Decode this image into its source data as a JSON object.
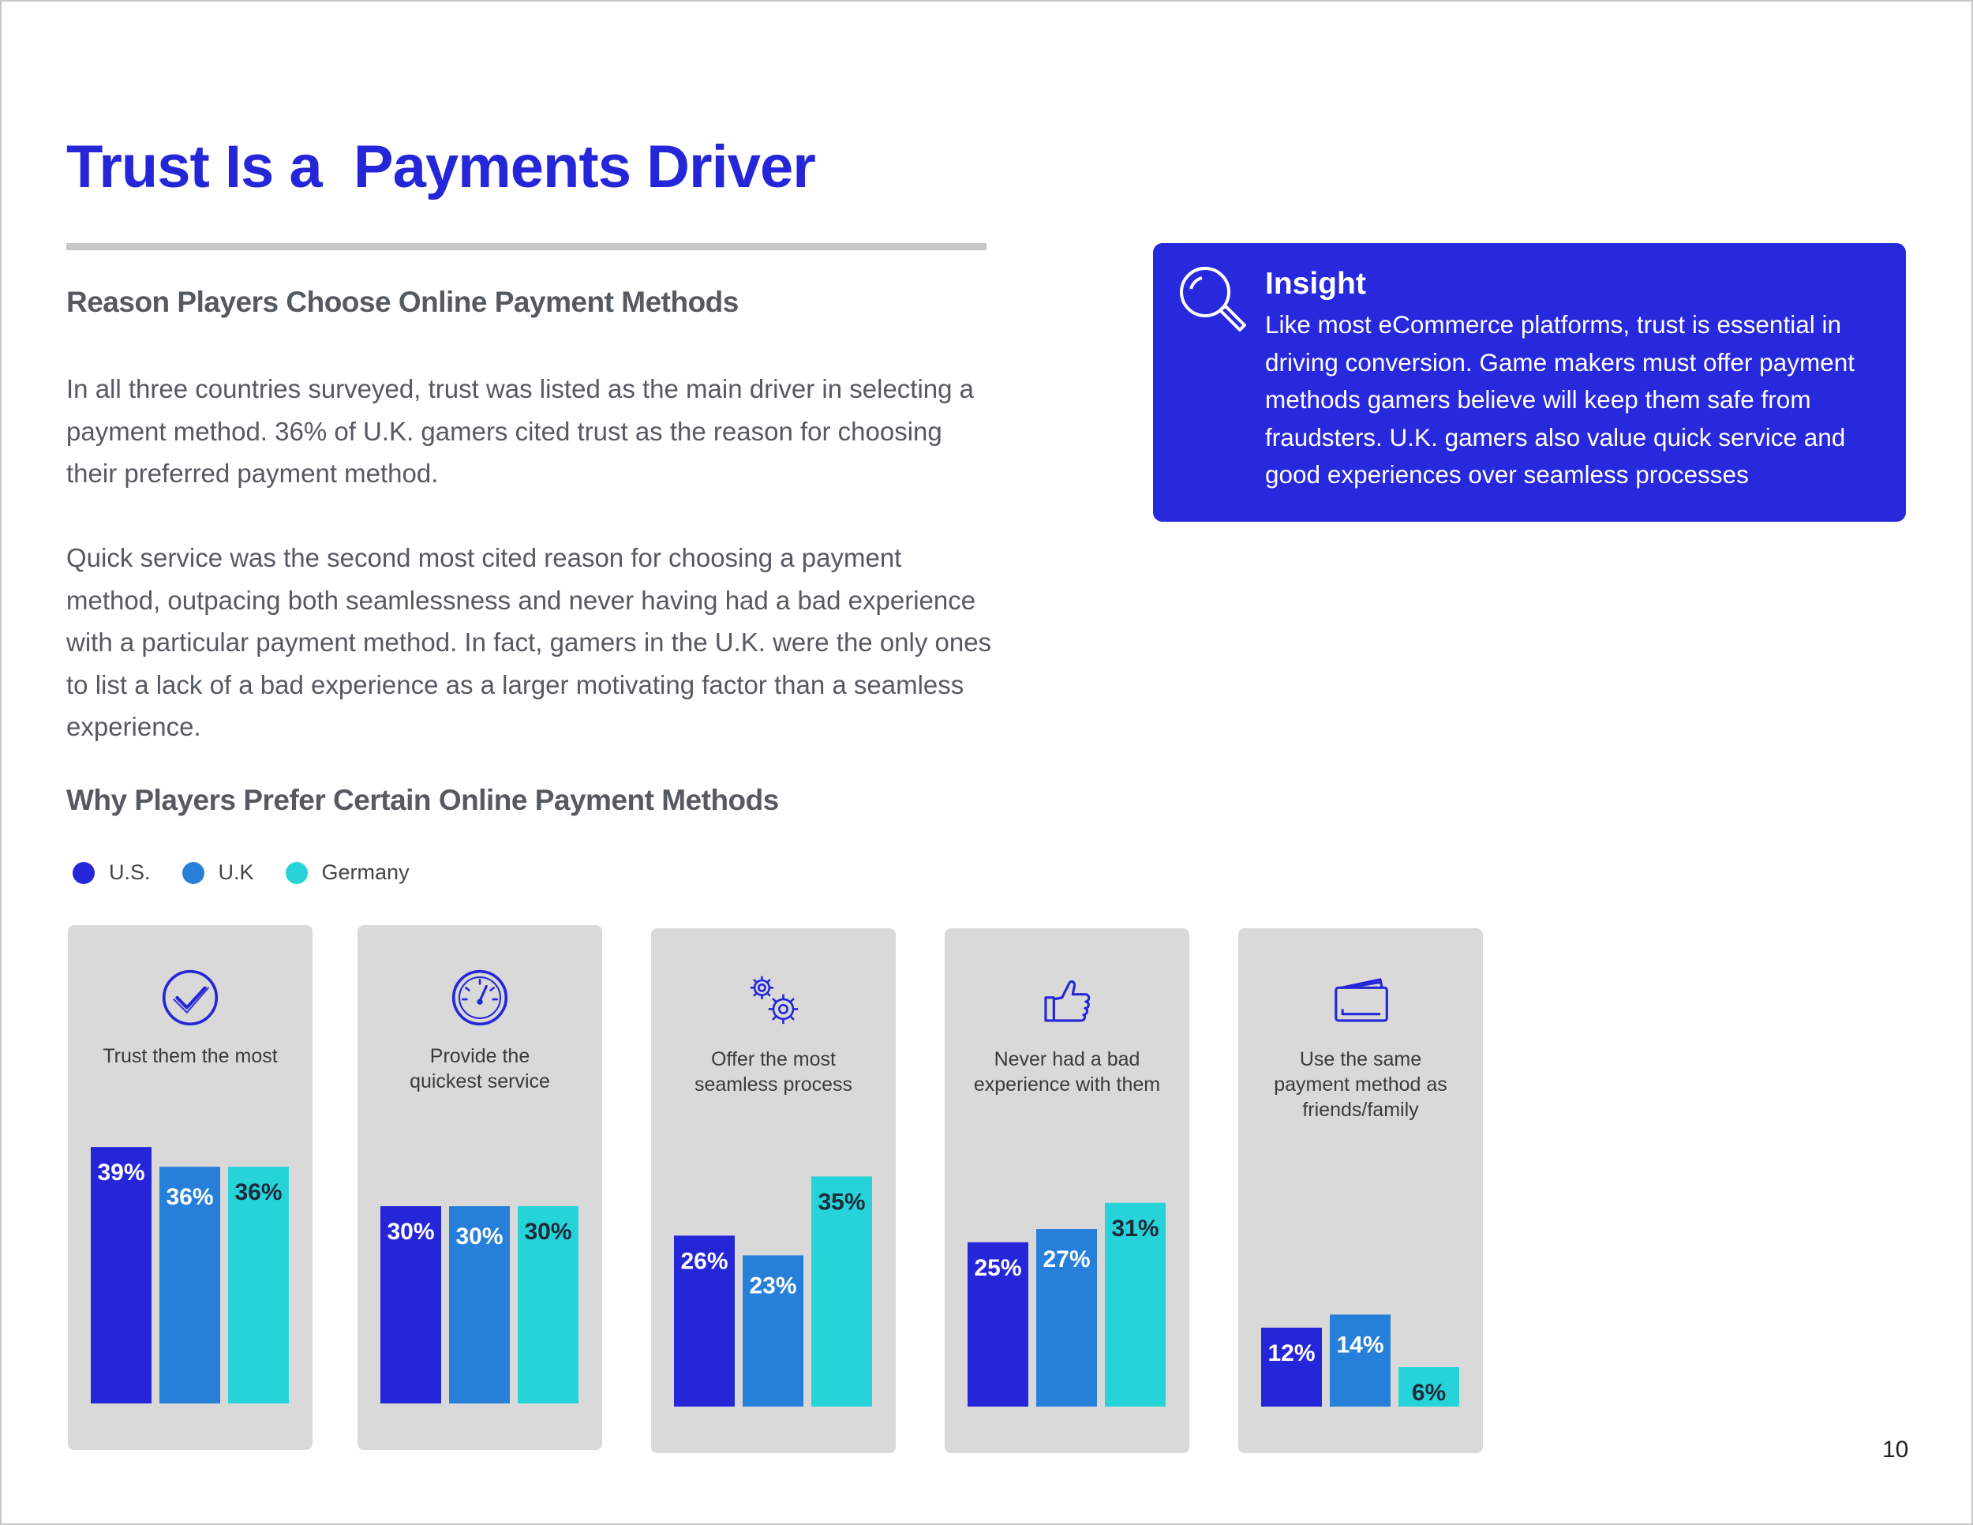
{
  "page": {
    "title": "Trust Is a  Payments Driver",
    "subtitle": "Reason Players Choose Online Payment Methods",
    "paragraph1": "In all three countries surveyed, trust was listed as the main driver in selecting a payment method. 36% of U.K. gamers cited trust as the reason for choosing their preferred payment method.",
    "paragraph2": "Quick service was the second most cited reason for choosing a payment method, outpacing both seamlessness and never having had a bad experience with a particular payment method. In fact, gamers in the U.K. were the only ones to list a lack of a bad experience as a larger motivating factor than a seamless experience.",
    "chart_heading": "Why Players Prefer Certain Online Payment Methods",
    "page_number": "10"
  },
  "insight": {
    "title": "Insight",
    "text": "Like most eCommerce platforms, trust is essential in driving conversion. Game makers must offer payment methods gamers believe will keep them safe from fraudsters. U.K. gamers also value quick service and good experiences over seamless processes",
    "icon": "magnifier-icon"
  },
  "colors": {
    "title": "#2626d9",
    "us": "#2626d9",
    "uk": "#2680d9",
    "germany": "#26d3d9",
    "panel": "#d9d9d9"
  },
  "chart_data": {
    "type": "bar",
    "categories": [
      "Trust them the most",
      "Provide the quickest service",
      "Offer the most seamless process",
      "Never had a bad experience with them",
      "Use the same payment method as friends/family"
    ],
    "category_lines": [
      [
        "Trust them the most"
      ],
      [
        "Provide the",
        "quickest service"
      ],
      [
        "Offer the most",
        "seamless process"
      ],
      [
        "Never had a bad",
        "experience with them"
      ],
      [
        "Use the same",
        "payment method as",
        "friends/family"
      ]
    ],
    "category_icons": [
      "checkmark-circle-icon",
      "speedometer-icon",
      "gears-icon",
      "thumbs-up-icon",
      "wallet-icon"
    ],
    "unit": "%",
    "series": [
      {
        "name": "U.S.",
        "values": [
          39,
          30,
          26,
          25,
          12
        ]
      },
      {
        "name": "U.K",
        "values": [
          36,
          30,
          23,
          27,
          14
        ]
      },
      {
        "name": "Germany",
        "values": [
          36,
          30,
          35,
          31,
          6
        ]
      }
    ],
    "legend_position": "top-left",
    "ylim": [
      0,
      40
    ],
    "grid": false
  }
}
